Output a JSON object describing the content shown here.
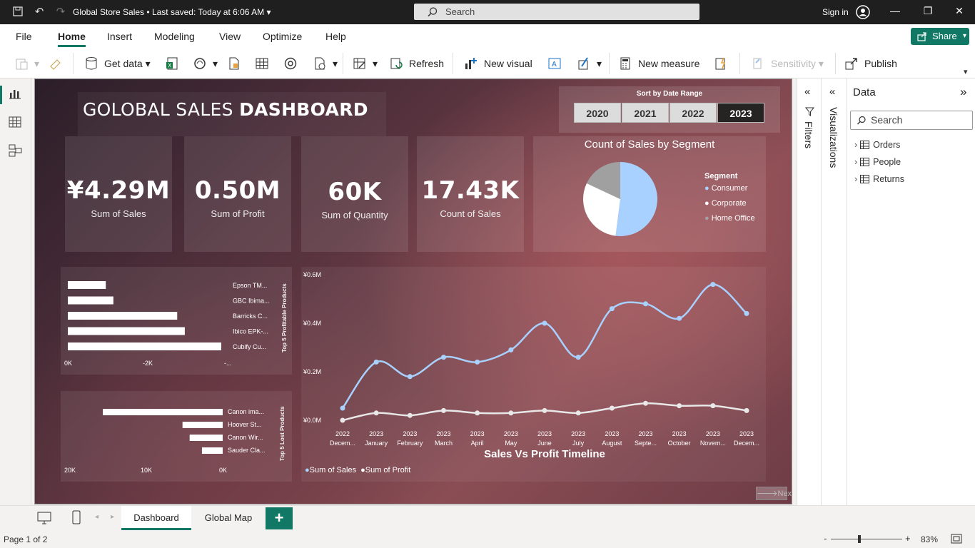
{
  "titlebar": {
    "document_title": "Global Store Sales",
    "saved_status": "• Last saved: Today at 6:06 AM",
    "search_placeholder": "Search",
    "signin_label": "Sign in"
  },
  "menu": {
    "items": [
      "File",
      "Home",
      "Insert",
      "Modeling",
      "View",
      "Optimize",
      "Help"
    ],
    "active": "Home",
    "share_label": "Share"
  },
  "ribbon": {
    "get_data": "Get data",
    "refresh": "Refresh",
    "new_visual": "New visual",
    "new_measure": "New measure",
    "sensitivity": "Sensitivity",
    "publish": "Publish"
  },
  "dashboard": {
    "title_light": "GOLOBAL SALES",
    "title_bold": "DASHBOARD",
    "slicer": {
      "title": "Sort by Date Range",
      "years": [
        "2020",
        "2021",
        "2022",
        "2023"
      ],
      "selected": "2023"
    },
    "kpis": [
      {
        "value": "¥4.29M",
        "label": "Sum of Sales"
      },
      {
        "value": "0.50M",
        "label": "Sum of Profit"
      },
      {
        "value": "60K",
        "label": "Sum of Quantity"
      },
      {
        "value": "17.43K",
        "label": "Count of Sales"
      }
    ],
    "pie": {
      "title": "Count of Sales by Segment",
      "legend_title": "Segment",
      "segments": [
        {
          "name": "Consumer",
          "value": 52,
          "color": "#a8d1ff"
        },
        {
          "name": "Corporate",
          "value": 30,
          "color": "#ffffff"
        },
        {
          "name": "Home Office",
          "value": 18,
          "color": "#a0a0a0"
        }
      ]
    },
    "top_profitable": {
      "axis_title": "Top 5 Profitable Products",
      "labels": [
        "Epson TM...",
        "GBC Ibima...",
        "Barricks C...",
        "Ibico EPK-...",
        "Cubify Cu..."
      ],
      "values": [
        2.5,
        3.0,
        7.2,
        7.7,
        10.1
      ],
      "ticks": [
        "0K",
        "-2K",
        "-..."
      ]
    },
    "top_lost": {
      "axis_title": "Top 5 Lost Products",
      "labels": [
        "Canon ima...",
        "Hoover St...",
        "Canon Wir...",
        "Sauder Cla..."
      ],
      "values": [
        18.5,
        6.2,
        5.1,
        3.2
      ],
      "ticks": [
        "20K",
        "10K",
        "0K"
      ]
    },
    "line_chart": {
      "title": "Sales Vs Profit Timeline",
      "y_ticks": [
        "¥0.6M",
        "¥0.4M",
        "¥0.2M",
        "¥0.0M"
      ],
      "x_labels": [
        [
          "2022",
          "Decem..."
        ],
        [
          "2023",
          "January"
        ],
        [
          "2023",
          "February"
        ],
        [
          "2023",
          "March"
        ],
        [
          "2023",
          "April"
        ],
        [
          "2023",
          "May"
        ],
        [
          "2023",
          "June"
        ],
        [
          "2023",
          "July"
        ],
        [
          "2023",
          "August"
        ],
        [
          "2023",
          "Septe..."
        ],
        [
          "2023",
          "October"
        ],
        [
          "2023",
          "Novem..."
        ],
        [
          "2023",
          "Decem..."
        ]
      ],
      "legend": [
        "Sum of Sales",
        "Sum of Profit"
      ]
    },
    "next_label": "Next"
  },
  "chart_data": {
    "type": "line",
    "title": "Sales Vs Profit Timeline",
    "ylim": [
      0,
      0.6
    ],
    "x": [
      "2022 December",
      "2023 January",
      "2023 February",
      "2023 March",
      "2023 April",
      "2023 May",
      "2023 June",
      "2023 July",
      "2023 August",
      "2023 September",
      "2023 October",
      "2023 November",
      "2023 December"
    ],
    "series": [
      {
        "name": "Sum of Sales",
        "color": "#a8d1ff",
        "values": [
          0.05,
          0.24,
          0.18,
          0.26,
          0.24,
          0.29,
          0.4,
          0.26,
          0.46,
          0.48,
          0.42,
          0.56,
          0.44
        ]
      },
      {
        "name": "Sum of Profit",
        "color": "#e8e8e8",
        "values": [
          0.0,
          0.03,
          0.02,
          0.04,
          0.03,
          0.03,
          0.04,
          0.03,
          0.05,
          0.07,
          0.06,
          0.06,
          0.04
        ]
      }
    ]
  },
  "panels": {
    "filters": "Filters",
    "visualizations": "Visualizations",
    "data_title": "Data",
    "data_search": "Search",
    "tables": [
      "Orders",
      "People",
      "Returns"
    ]
  },
  "tabs": {
    "items": [
      "Dashboard",
      "Global Map"
    ],
    "active": "Dashboard"
  },
  "status": {
    "page": "Page 1 of 2",
    "zoom": "83%"
  }
}
